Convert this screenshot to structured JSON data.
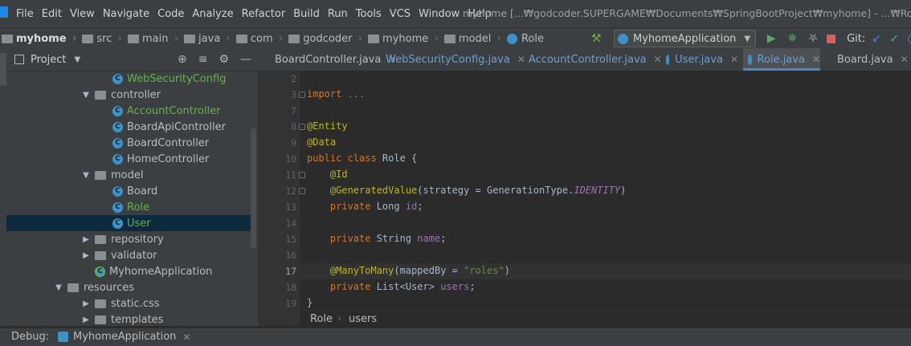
{
  "menu": [
    "File",
    "Edit",
    "View",
    "Navigate",
    "Code",
    "Analyze",
    "Refactor",
    "Build",
    "Run",
    "Tools",
    "VCS",
    "Window",
    "Help"
  ],
  "window_title": "myhome [...₩godcoder.SUPERGAME₩Documents₩SpringBootProject₩myhome] - ...₩Role.java",
  "breadcrumbs": [
    "myhome",
    "src",
    "main",
    "java",
    "com",
    "godcoder",
    "myhome",
    "model",
    "Role"
  ],
  "run": {
    "config": "MyhomeApplication",
    "git_label": "Git:"
  },
  "project_panel": {
    "title": "Project",
    "tree": [
      {
        "label": "WebSecurityConfig",
        "kind": "class",
        "level": 4,
        "color": "green"
      },
      {
        "label": "controller",
        "kind": "folder",
        "level": 3,
        "open": true
      },
      {
        "label": "AccountController",
        "kind": "class",
        "level": 4,
        "color": "green"
      },
      {
        "label": "BoardApiController",
        "kind": "class",
        "level": 4
      },
      {
        "label": "BoardController",
        "kind": "class",
        "level": 4
      },
      {
        "label": "HomeController",
        "kind": "class",
        "level": 4
      },
      {
        "label": "model",
        "kind": "folder",
        "level": 3,
        "open": true
      },
      {
        "label": "Board",
        "kind": "class",
        "level": 4
      },
      {
        "label": "Role",
        "kind": "class",
        "level": 4,
        "color": "green"
      },
      {
        "label": "User",
        "kind": "class",
        "level": 4,
        "color": "green",
        "selected": true
      },
      {
        "label": "repository",
        "kind": "folder",
        "level": 3,
        "open": false
      },
      {
        "label": "validator",
        "kind": "folder",
        "level": 3,
        "open": false
      },
      {
        "label": "MyhomeApplication",
        "kind": "app",
        "level": 3
      },
      {
        "label": "resources",
        "kind": "folder",
        "level": 2,
        "open": true
      },
      {
        "label": "static.css",
        "kind": "folder",
        "level": 3,
        "open": false
      },
      {
        "label": "templates",
        "kind": "folder",
        "level": 3,
        "open": false
      }
    ]
  },
  "tabs": [
    {
      "label": "BoardController.java",
      "modified": false,
      "active": false
    },
    {
      "label": "WebSecurityConfig.java",
      "modified": true,
      "active": false
    },
    {
      "label": "AccountController.java",
      "modified": true,
      "active": false
    },
    {
      "label": "User.java",
      "modified": true,
      "active": false
    },
    {
      "label": "Role.java",
      "modified": true,
      "active": true
    },
    {
      "label": "Board.java",
      "modified": false,
      "active": false
    }
  ],
  "editor": {
    "lines": [
      {
        "n": "2",
        "html": ""
      },
      {
        "n": "3",
        "html": "<span class=\"kw\">import</span> <span style=\"color:#808080\">...</span>",
        "fold": true
      },
      {
        "n": "7",
        "html": ""
      },
      {
        "n": "8",
        "html": "<span class=\"an\">@Entity</span>",
        "fold": true
      },
      {
        "n": "9",
        "html": "<span class=\"an\">@Data</span>"
      },
      {
        "n": "10",
        "html": "<span class=\"kw\">public class</span> Role {"
      },
      {
        "n": "11",
        "html": "    <span class=\"an\">@Id</span>",
        "fold": true
      },
      {
        "n": "12",
        "html": "    <span class=\"an\">@GeneratedValue</span>(strategy = GenerationType.<span class=\"it\">IDENTITY</span>)",
        "fold": true
      },
      {
        "n": "13",
        "html": "    <span class=\"kw\">private</span> Long <span class=\"fld\">id</span>;"
      },
      {
        "n": "14",
        "html": ""
      },
      {
        "n": "15",
        "html": "    <span class=\"kw\">private</span> String <span class=\"fld\">name</span>;"
      },
      {
        "n": "16",
        "html": ""
      },
      {
        "n": "17",
        "html": "    <span class=\"an\">@ManyToMany</span>(mappedBy = <span class=\"str\">\"roles\"</span>)",
        "current": true
      },
      {
        "n": "18",
        "html": "    <span class=\"kw\">private</span> List&lt;User&gt; <span class=\"fld\">users</span>;"
      },
      {
        "n": "19",
        "html": "}"
      }
    ],
    "crumbs": [
      "Role",
      "users"
    ]
  },
  "debug": {
    "label": "Debug:",
    "tab": "MyhomeApplication"
  }
}
